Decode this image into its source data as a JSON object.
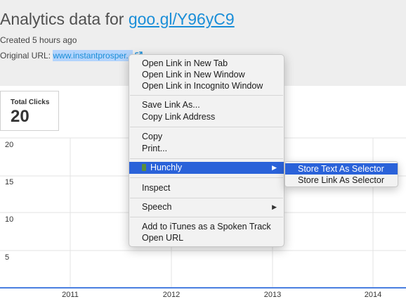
{
  "header": {
    "title_prefix": "Analytics data for ",
    "short_link": "goo.gl/Y96yC9",
    "created": "Created 5 hours ago",
    "original_url_label": "Original URL: ",
    "original_url": "www.instantprosper..."
  },
  "stat": {
    "label": "Total Clicks",
    "value": "20"
  },
  "chart": {
    "y_ticks": [
      "20",
      "15",
      "10",
      "5"
    ],
    "x_ticks": [
      "2011",
      "2012",
      "2013",
      "2014"
    ]
  },
  "context_menu": {
    "items": [
      "Open Link in New Tab",
      "Open Link in New Window",
      "Open Link in Incognito Window",
      "Save Link As...",
      "Copy Link Address",
      "Copy",
      "Print...",
      "Hunchly",
      "Inspect",
      "Speech",
      "Add to iTunes as a Spoken Track",
      "Open URL"
    ]
  },
  "submenu": {
    "items": [
      "Store Text As Selector",
      "Store Link As Selector"
    ]
  },
  "colors": {
    "link": "#1a8ed8",
    "selection": "#2a62d9",
    "axis": "#4a7fe0"
  }
}
